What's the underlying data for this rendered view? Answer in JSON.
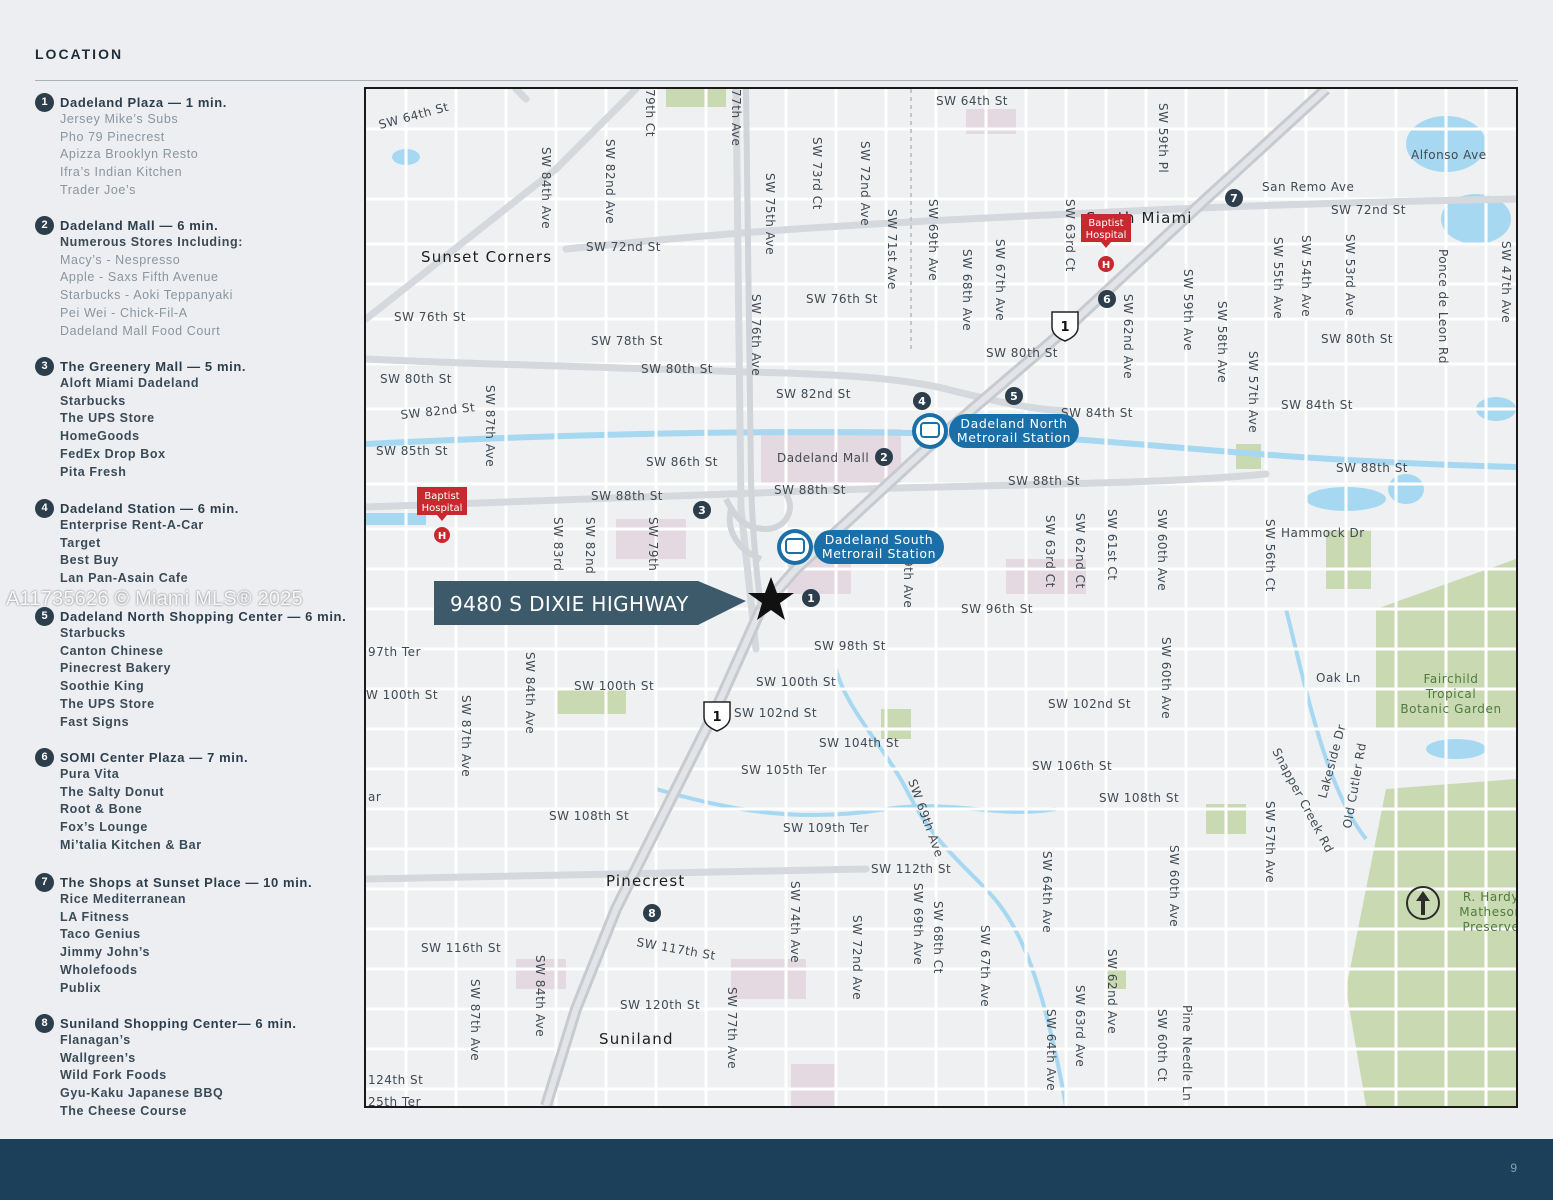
{
  "header": {
    "title": "LOCATION"
  },
  "groups": [
    {
      "num": "1",
      "title": "Dadeland Plaza — 1 min.",
      "style": "light",
      "items": [
        "Jersey Mike’s Subs",
        "Pho 79 Pinecrest",
        "Apizza Brooklyn Resto",
        "Ifra’s Indian Kitchen",
        "Trader Joe’s"
      ]
    },
    {
      "num": "2",
      "title": "Dadeland Mall — 6 min.",
      "subtitle": "Numerous Stores Including:",
      "style": "light",
      "items": [
        "Macy’s - Nespresso",
        "Apple - Saxs Fifth Avenue",
        "Starbucks - Aoki Teppanyaki",
        "Pei Wei - Chick-Fil-A",
        "Dadeland Mall Food Court"
      ]
    },
    {
      "num": "3",
      "title": "The Greenery Mall — 5 min.",
      "style": "bold",
      "items": [
        "Aloft Miami Dadeland",
        "Starbucks",
        "The UPS Store",
        "HomeGoods",
        "FedEx Drop Box",
        "Pita Fresh"
      ]
    },
    {
      "num": "4",
      "title": "Dadeland Station — 6 min.",
      "style": "bold",
      "items": [
        "Enterprise Rent-A-Car",
        "Target",
        "Best Buy",
        "Lan Pan-Asain Cafe"
      ]
    },
    {
      "num": "5",
      "title": "Dadeland North Shopping Center — 6 min.",
      "style": "bold",
      "items": [
        "Starbucks",
        "Canton Chinese",
        "Pinecrest Bakery",
        "Soothie King",
        "The UPS Store",
        "Fast Signs"
      ]
    },
    {
      "num": "6",
      "title": "SOMI Center Plaza — 7 min.",
      "style": "bold",
      "items": [
        "Pura Vita",
        "The Salty Donut",
        "Root & Bone",
        "Fox’s Lounge",
        "Mi’talia Kitchen & Bar"
      ]
    },
    {
      "num": "7",
      "title": "The Shops at Sunset Place — 10 min.",
      "style": "bold",
      "items": [
        "Rice Mediterranean",
        "LA Fitness",
        "Taco Genius",
        "Jimmy John’s",
        "Wholefoods",
        "Publix"
      ]
    },
    {
      "num": "8",
      "title": "Suniland Shopping Center— 6 min.",
      "style": "bold",
      "items": [
        "Flanagan’s",
        "Wallgreen’s",
        "Wild Fork Foods",
        "Gyu-Kaku Japanese BBQ",
        "The Cheese Course"
      ]
    }
  ],
  "map": {
    "property_label": "9480 S DIXIE HIGHWAY",
    "areas": [
      "Sunset Corners",
      "South Miami",
      "Pinecrest",
      "Suniland"
    ],
    "parks": [
      "Fairchild",
      "Tropical",
      "Botanic Garden",
      "R. Hardy",
      "Matheson",
      "Preserve"
    ],
    "stations": [
      {
        "line1": "Dadeland North",
        "line2": "Metrorail Station"
      },
      {
        "line1": "Dadeland South",
        "line2": "Metrorail Station"
      }
    ],
    "hospital_line1": "Baptist",
    "hospital_line2": "Hospital",
    "hospital_symbol": "H",
    "highway_shield": "1",
    "mall_label": "Dadeland Mall",
    "streets_h": [
      "SW 64th St",
      "SW 64th St",
      "SW 72nd St",
      "SW 72nd St",
      "SW 76th St",
      "SW 76th St",
      "SW 78th St",
      "SW 80th St",
      "SW 80th St",
      "SW 80th St",
      "SW 80th St",
      "SW 82nd St",
      "SW 82nd St",
      "SW 84th St",
      "SW 84th St",
      "SW 85th St",
      "SW 86th St",
      "SW 88th St",
      "SW 88th St",
      "SW 88th St",
      "SW 88th St",
      "Hammock Dr",
      "SW 96th St",
      "SW 98th St",
      "97th Ter",
      "W 100th St",
      "SW 100th St",
      "SW 100th St",
      "SW 102nd St",
      "SW 102nd St",
      "SW 104th St",
      "SW 105th Ter",
      "SW 106th St",
      "SW 108th St",
      "SW 108th St",
      "SW 109th Ter",
      "SW 112th St",
      "SW 116th St",
      "SW 117th St",
      "SW 120th St",
      "124th St",
      "25th Ter",
      "Alfonso Ave",
      "San Remo Ave",
      "Oak Ln"
    ],
    "streets_v": [
      "SW 84th Ave",
      "SW 82nd Ave",
      "79th Ct",
      "77th Ave",
      "SW 75th Ave",
      "SW 76th Ave",
      "SW 73rd Ct",
      "SW 72nd Ave",
      "SW 71st Ave",
      "SW 69th Ave",
      "SW 68th Ave",
      "SW 67th Ave",
      "SW 63rd Ct",
      "SW 62nd Ave",
      "SW 59th Pl",
      "SW 59th Ave",
      "SW 58th Ave",
      "SW 57th Ave",
      "SW 55th Ave",
      "SW 54th Ave",
      "SW 53rd Ave",
      "Ponce de Leon Rd",
      "SW 47th Ave",
      "SW 87th Ave",
      "SW 83rd",
      "SW 82nd",
      "SW 79th",
      "9th Ave",
      "SW 63rd Ct",
      "SW 62nd Ct",
      "SW 61st Ct",
      "SW 60th Ave",
      "SW 56th Ct",
      "SW 60th Ave",
      "SW 84th Ave",
      "SW 87th Ave",
      "SW 69th Ave",
      "Lakeside Dr",
      "Old Cutler Rd",
      "Snapper Creek Rd",
      "SW 57th Ave",
      "SW 74th Ave",
      "SW 72nd Ave",
      "SW 69th Ave",
      "SW 68th Ct",
      "SW 67th Ave",
      "SW 64th Ave",
      "SW 64th Ave",
      "SW 63rd Ave",
      "SW 62nd Ave",
      "SW 60th Ave",
      "SW 60th Ct",
      "Pine Needle Ln",
      "SW 87th Ave",
      "SW 84th Ave",
      "SW 77th Ave",
      "ar"
    ],
    "markers": [
      "1",
      "2",
      "3",
      "4",
      "5",
      "6",
      "7",
      "8"
    ]
  },
  "watermark": "A11735626 © Miami MLS® 2025",
  "footer": {
    "page_number": "9"
  },
  "colors": {
    "footer": "#1c4059",
    "badge": "#2c3e4c",
    "water": "#a5d7f0",
    "transit": "#1b6fa8",
    "hospital": "#c8282e",
    "park": "#c8d9b2"
  }
}
